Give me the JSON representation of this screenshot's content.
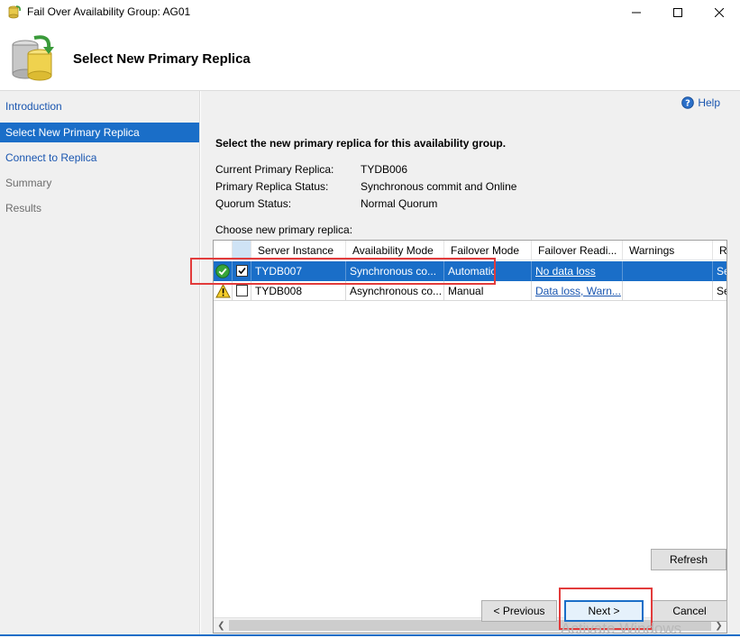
{
  "window": {
    "title": "Fail Over Availability Group: AG01",
    "controls": [
      "minimize",
      "maximize",
      "close"
    ]
  },
  "header": {
    "page_title": "Select New Primary Replica"
  },
  "sidebar": {
    "items": [
      {
        "label": "Introduction",
        "state": "link"
      },
      {
        "label": "Select New Primary Replica",
        "state": "active"
      },
      {
        "label": "Connect to Replica",
        "state": "link"
      },
      {
        "label": "Summary",
        "state": "disabled"
      },
      {
        "label": "Results",
        "state": "disabled"
      }
    ]
  },
  "content": {
    "help_label": "Help",
    "instruction": "Select the new primary replica for this availability group.",
    "fields": [
      {
        "label": "Current Primary Replica:",
        "value": "TYDB006"
      },
      {
        "label": "Primary Replica Status:",
        "value": "Synchronous commit and Online"
      },
      {
        "label": "Quorum Status:",
        "value": "Normal Quorum"
      }
    ],
    "choose_label": "Choose new primary replica:"
  },
  "grid": {
    "columns": [
      "Server Instance",
      "Availability Mode",
      "Failover Mode",
      "Failover Readi...",
      "Warnings",
      "R"
    ],
    "rows": [
      {
        "status_icon": "check-circle-icon",
        "checked": true,
        "selected": true,
        "server": "TYDB007",
        "availability": "Synchronous co...",
        "failover_mode": "Automatic",
        "readiness": "No data loss",
        "warnings": "",
        "role": "Se"
      },
      {
        "status_icon": "warning-icon",
        "checked": false,
        "selected": false,
        "server": "TYDB008",
        "availability": "Asynchronous co...",
        "failover_mode": "Manual",
        "readiness": "Data loss, Warn...",
        "warnings": "",
        "role": "Se"
      }
    ]
  },
  "buttons": {
    "refresh": "Refresh",
    "previous": "< Previous",
    "next": "Next >",
    "cancel": "Cancel"
  },
  "watermark": "Activate Windows",
  "colors": {
    "selection": "#1a6ec8",
    "link": "#1a56b0",
    "highlight": "#e23b3b"
  }
}
